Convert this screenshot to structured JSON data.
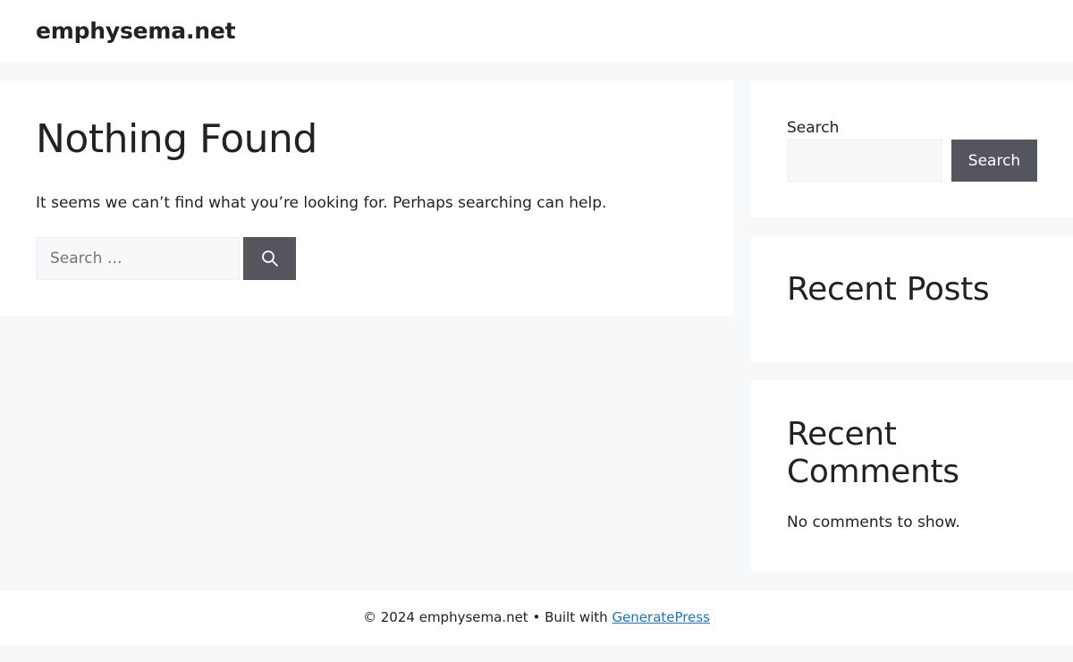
{
  "header": {
    "site_title": "emphysema.net"
  },
  "main": {
    "title": "Nothing Found",
    "message": "It seems we can’t find what you’re looking for. Perhaps searching can help.",
    "search": {
      "placeholder": "Search …",
      "value": "",
      "button_icon": "search-icon"
    }
  },
  "sidebar": {
    "search_widget": {
      "label": "Search",
      "value": "",
      "button_label": "Search"
    },
    "recent_posts": {
      "title": "Recent Posts"
    },
    "recent_comments": {
      "title": "Recent Comments",
      "empty_text": "No comments to show."
    }
  },
  "footer": {
    "copyright": "© 2024 emphysema.net • Built with ",
    "link_label": "GeneratePress"
  },
  "colors": {
    "background": "#f7f8f9",
    "button": "#55555e",
    "link": "#1e73be",
    "text": "#222222"
  }
}
